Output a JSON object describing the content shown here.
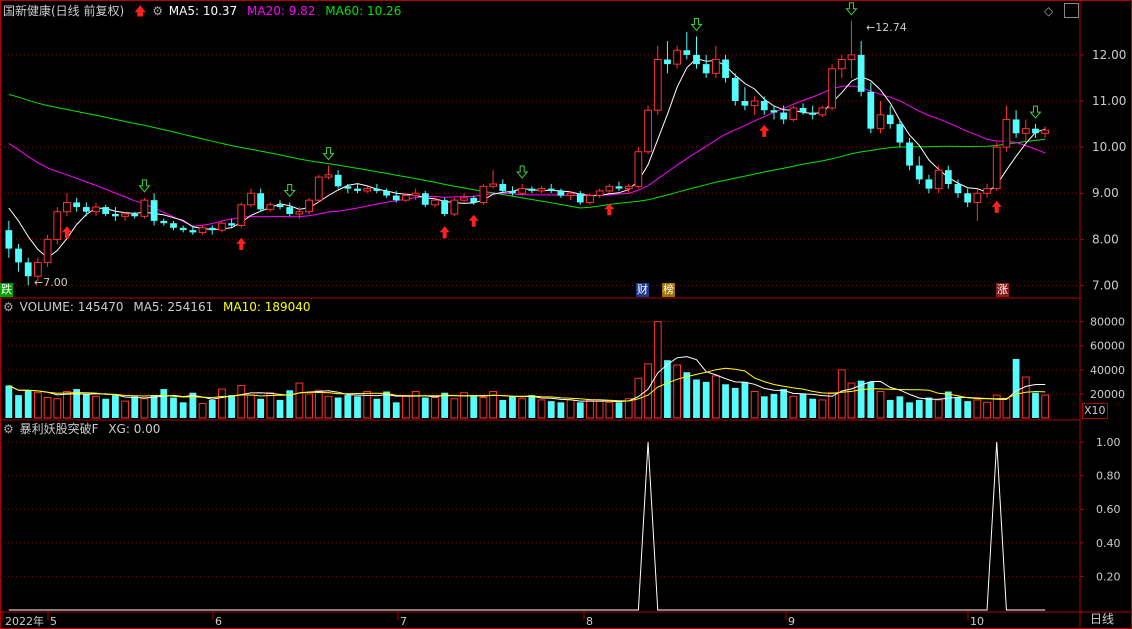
{
  "header": {
    "title": "国新健康(日线 前复权)",
    "ma5": "MA5: 10.37",
    "ma20": "MA20: 9.82",
    "ma60": "MA60: 10.26"
  },
  "volume_header": {
    "label": "VOLUME: 145470",
    "ma5": "MA5: 254161",
    "ma10": "MA10: 189040"
  },
  "indicator_header": {
    "label": "暴利妖股突破F",
    "xg": "XG: 0.00"
  },
  "price_axis": [
    "12.00",
    "11.00",
    "10.00",
    "9.00",
    "8.00",
    "7.00"
  ],
  "volume_axis": [
    "80000",
    "60000",
    "40000",
    "20000"
  ],
  "volume_multiplier": "X10",
  "indicator_axis": [
    "1.00",
    "0.80",
    "0.60",
    "0.40",
    "0.20"
  ],
  "date_axis": [
    "2022年",
    "5",
    "6",
    "7",
    "8",
    "9",
    "10"
  ],
  "period_label": "日线",
  "annotations": {
    "low_price": "7.00",
    "high_price": "12.74",
    "left_tag": "跌",
    "tag_cai": "财",
    "tag_bang": "榜",
    "tag_zhang": "涨"
  },
  "colors": {
    "up": "#ff3232",
    "down": "#54fcfc",
    "ma5": "#ffffff",
    "ma20": "#ff00ff",
    "ma60": "#00e600",
    "vol_ma10": "#ffff00",
    "grid": "#800000",
    "border": "#b00000"
  },
  "chart_data": {
    "type": "candlestick",
    "dates_axis": [
      "5",
      "6",
      "7",
      "8",
      "9",
      "10"
    ],
    "ylim": [
      6.8,
      13.0
    ],
    "candles": [
      [
        8.2,
        8.4,
        7.6,
        7.8
      ],
      [
        7.8,
        7.9,
        7.3,
        7.5
      ],
      [
        7.5,
        7.6,
        7.0,
        7.2
      ],
      [
        7.2,
        7.6,
        7.1,
        7.5
      ],
      [
        7.5,
        8.1,
        7.4,
        8.0
      ],
      [
        8.0,
        8.7,
        7.9,
        8.6
      ],
      [
        8.6,
        9.0,
        8.5,
        8.8
      ],
      [
        8.8,
        8.9,
        8.6,
        8.7
      ],
      [
        8.7,
        8.8,
        8.5,
        8.6
      ],
      [
        8.6,
        8.8,
        8.5,
        8.7
      ],
      [
        8.7,
        8.75,
        8.5,
        8.55
      ],
      [
        8.55,
        8.7,
        8.4,
        8.5
      ],
      [
        8.5,
        8.6,
        8.4,
        8.55
      ],
      [
        8.55,
        8.6,
        8.45,
        8.5
      ],
      [
        8.5,
        8.9,
        8.45,
        8.85
      ],
      [
        8.85,
        9.0,
        8.3,
        8.4
      ],
      [
        8.4,
        8.45,
        8.3,
        8.35
      ],
      [
        8.35,
        8.4,
        8.2,
        8.25
      ],
      [
        8.25,
        8.3,
        8.15,
        8.2
      ],
      [
        8.2,
        8.3,
        8.1,
        8.15
      ],
      [
        8.15,
        8.3,
        8.1,
        8.25
      ],
      [
        8.25,
        8.3,
        8.1,
        8.2
      ],
      [
        8.2,
        8.4,
        8.15,
        8.35
      ],
      [
        8.35,
        8.45,
        8.25,
        8.3
      ],
      [
        8.3,
        8.8,
        8.25,
        8.75
      ],
      [
        8.75,
        9.1,
        8.7,
        9.0
      ],
      [
        9.0,
        9.1,
        8.6,
        8.65
      ],
      [
        8.65,
        8.8,
        8.6,
        8.75
      ],
      [
        8.75,
        8.85,
        8.65,
        8.7
      ],
      [
        8.7,
        8.8,
        8.5,
        8.55
      ],
      [
        8.55,
        8.7,
        8.45,
        8.6
      ],
      [
        8.6,
        8.9,
        8.55,
        8.85
      ],
      [
        8.85,
        9.4,
        8.8,
        9.35
      ],
      [
        9.35,
        9.6,
        9.3,
        9.4
      ],
      [
        9.4,
        9.5,
        9.1,
        9.15
      ],
      [
        9.15,
        9.2,
        9.0,
        9.1
      ],
      [
        9.1,
        9.2,
        9.0,
        9.05
      ],
      [
        9.05,
        9.15,
        9.0,
        9.1
      ],
      [
        9.1,
        9.2,
        9.0,
        9.05
      ],
      [
        9.05,
        9.1,
        8.9,
        8.95
      ],
      [
        8.95,
        9.05,
        8.8,
        8.85
      ],
      [
        8.85,
        9.0,
        8.8,
        8.95
      ],
      [
        8.95,
        9.1,
        8.85,
        9.0
      ],
      [
        9.0,
        9.05,
        8.7,
        8.75
      ],
      [
        8.75,
        8.9,
        8.7,
        8.85
      ],
      [
        8.85,
        8.9,
        8.5,
        8.55
      ],
      [
        8.55,
        8.9,
        8.5,
        8.85
      ],
      [
        8.85,
        9.0,
        8.8,
        8.9
      ],
      [
        8.9,
        8.95,
        8.75,
        8.8
      ],
      [
        8.8,
        9.2,
        8.75,
        9.15
      ],
      [
        9.15,
        9.5,
        9.1,
        9.2
      ],
      [
        9.2,
        9.3,
        9.0,
        9.05
      ],
      [
        9.05,
        9.15,
        8.95,
        9.0
      ],
      [
        9.0,
        9.2,
        8.95,
        9.1
      ],
      [
        9.1,
        9.15,
        9.0,
        9.05
      ],
      [
        9.05,
        9.15,
        9.0,
        9.1
      ],
      [
        9.1,
        9.2,
        9.0,
        9.05
      ],
      [
        9.05,
        9.1,
        8.9,
        8.95
      ],
      [
        8.95,
        9.05,
        8.85,
        9.0
      ],
      [
        9.0,
        9.05,
        8.75,
        8.8
      ],
      [
        8.8,
        9.0,
        8.75,
        8.95
      ],
      [
        8.95,
        9.1,
        8.9,
        9.05
      ],
      [
        9.05,
        9.2,
        9.0,
        9.15
      ],
      [
        9.15,
        9.25,
        9.05,
        9.1
      ],
      [
        9.1,
        9.2,
        9.0,
        9.15
      ],
      [
        9.15,
        10.0,
        9.1,
        9.9
      ],
      [
        9.9,
        10.9,
        9.85,
        10.8
      ],
      [
        10.8,
        12.2,
        10.7,
        11.9
      ],
      [
        11.9,
        12.3,
        11.6,
        11.8
      ],
      [
        11.8,
        12.2,
        11.7,
        12.1
      ],
      [
        12.1,
        12.5,
        11.9,
        12.0
      ],
      [
        12.0,
        12.4,
        11.7,
        11.8
      ],
      [
        11.8,
        12.0,
        11.5,
        11.6
      ],
      [
        11.6,
        12.2,
        11.5,
        11.9
      ],
      [
        11.9,
        12.0,
        11.4,
        11.5
      ],
      [
        11.5,
        11.6,
        10.9,
        11.0
      ],
      [
        11.0,
        11.3,
        10.8,
        10.9
      ],
      [
        10.9,
        11.1,
        10.7,
        11.0
      ],
      [
        11.0,
        11.1,
        10.7,
        10.8
      ],
      [
        10.8,
        10.9,
        10.6,
        10.75
      ],
      [
        10.75,
        10.9,
        10.5,
        10.6
      ],
      [
        10.6,
        10.9,
        10.55,
        10.85
      ],
      [
        10.85,
        10.95,
        10.7,
        10.75
      ],
      [
        10.75,
        10.9,
        10.6,
        10.7
      ],
      [
        10.7,
        10.9,
        10.65,
        10.85
      ],
      [
        10.85,
        11.8,
        10.8,
        11.7
      ],
      [
        11.7,
        12.0,
        11.5,
        11.9
      ],
      [
        11.9,
        12.74,
        11.5,
        12.0
      ],
      [
        12.0,
        12.3,
        11.1,
        11.2
      ],
      [
        11.2,
        11.4,
        10.3,
        10.4
      ],
      [
        10.4,
        11.0,
        10.3,
        10.7
      ],
      [
        10.7,
        10.9,
        10.4,
        10.5
      ],
      [
        10.5,
        10.6,
        10.0,
        10.1
      ],
      [
        10.1,
        10.2,
        9.5,
        9.6
      ],
      [
        9.6,
        9.8,
        9.2,
        9.3
      ],
      [
        9.3,
        9.4,
        9.0,
        9.1
      ],
      [
        9.1,
        9.6,
        9.0,
        9.5
      ],
      [
        9.5,
        9.6,
        9.1,
        9.2
      ],
      [
        9.2,
        9.3,
        8.9,
        9.0
      ],
      [
        9.0,
        9.1,
        8.7,
        8.8
      ],
      [
        8.8,
        9.1,
        8.4,
        9.0
      ],
      [
        9.0,
        9.2,
        8.9,
        9.1
      ],
      [
        9.1,
        10.1,
        9.05,
        10.0
      ],
      [
        10.0,
        10.9,
        9.9,
        10.6
      ],
      [
        10.6,
        10.8,
        10.2,
        10.3
      ],
      [
        10.3,
        10.6,
        10.1,
        10.4
      ],
      [
        10.4,
        10.5,
        10.2,
        10.3
      ],
      [
        10.3,
        10.45,
        10.2,
        10.37
      ]
    ],
    "volumes": [
      27,
      19,
      23,
      21,
      17,
      16,
      22,
      24,
      20,
      18,
      16,
      19,
      14,
      18,
      16,
      19,
      24,
      17,
      13,
      21,
      12,
      15,
      24,
      19,
      27,
      19,
      16,
      21,
      15,
      23,
      29,
      20,
      23,
      18,
      17,
      19,
      18,
      22,
      16,
      22,
      13,
      18,
      22,
      17,
      17,
      21,
      16,
      21,
      18,
      17,
      22,
      15,
      18,
      16,
      19,
      15,
      14,
      13,
      15,
      13,
      15,
      14,
      13,
      13,
      16,
      33,
      45,
      80,
      48,
      44,
      38,
      32,
      30,
      35,
      28,
      25,
      30,
      22,
      18,
      20,
      24,
      18,
      20,
      16,
      15,
      21,
      40,
      29,
      31,
      30,
      22,
      15,
      18,
      13,
      15,
      17,
      15,
      22,
      17,
      14,
      15,
      13,
      19,
      16,
      49,
      34,
      21,
      19
    ],
    "indicator": {
      "name": "XG",
      "peaks_at_candle": [
        66,
        102
      ],
      "peak_value": 1.0
    }
  }
}
